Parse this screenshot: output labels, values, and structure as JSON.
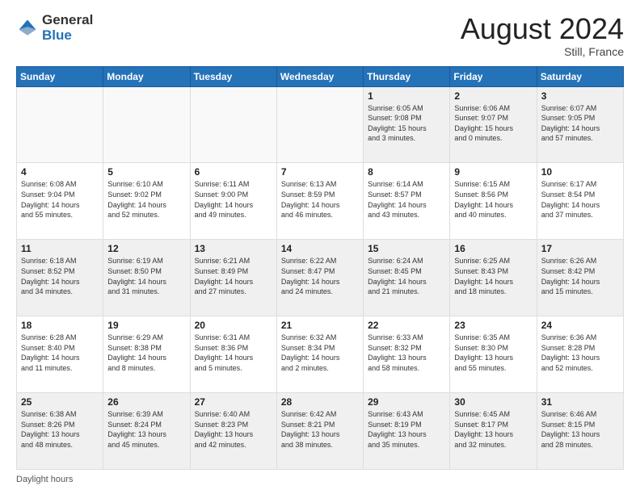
{
  "logo": {
    "general": "General",
    "blue": "Blue"
  },
  "header": {
    "month_year": "August 2024",
    "location": "Still, France"
  },
  "days_of_week": [
    "Sunday",
    "Monday",
    "Tuesday",
    "Wednesday",
    "Thursday",
    "Friday",
    "Saturday"
  ],
  "weeks": [
    [
      {
        "num": "",
        "info": "",
        "empty": true
      },
      {
        "num": "",
        "info": "",
        "empty": true
      },
      {
        "num": "",
        "info": "",
        "empty": true
      },
      {
        "num": "",
        "info": "",
        "empty": true
      },
      {
        "num": "1",
        "info": "Sunrise: 6:05 AM\nSunset: 9:08 PM\nDaylight: 15 hours\nand 3 minutes.",
        "empty": false
      },
      {
        "num": "2",
        "info": "Sunrise: 6:06 AM\nSunset: 9:07 PM\nDaylight: 15 hours\nand 0 minutes.",
        "empty": false
      },
      {
        "num": "3",
        "info": "Sunrise: 6:07 AM\nSunset: 9:05 PM\nDaylight: 14 hours\nand 57 minutes.",
        "empty": false
      }
    ],
    [
      {
        "num": "4",
        "info": "Sunrise: 6:08 AM\nSunset: 9:04 PM\nDaylight: 14 hours\nand 55 minutes.",
        "empty": false
      },
      {
        "num": "5",
        "info": "Sunrise: 6:10 AM\nSunset: 9:02 PM\nDaylight: 14 hours\nand 52 minutes.",
        "empty": false
      },
      {
        "num": "6",
        "info": "Sunrise: 6:11 AM\nSunset: 9:00 PM\nDaylight: 14 hours\nand 49 minutes.",
        "empty": false
      },
      {
        "num": "7",
        "info": "Sunrise: 6:13 AM\nSunset: 8:59 PM\nDaylight: 14 hours\nand 46 minutes.",
        "empty": false
      },
      {
        "num": "8",
        "info": "Sunrise: 6:14 AM\nSunset: 8:57 PM\nDaylight: 14 hours\nand 43 minutes.",
        "empty": false
      },
      {
        "num": "9",
        "info": "Sunrise: 6:15 AM\nSunset: 8:56 PM\nDaylight: 14 hours\nand 40 minutes.",
        "empty": false
      },
      {
        "num": "10",
        "info": "Sunrise: 6:17 AM\nSunset: 8:54 PM\nDaylight: 14 hours\nand 37 minutes.",
        "empty": false
      }
    ],
    [
      {
        "num": "11",
        "info": "Sunrise: 6:18 AM\nSunset: 8:52 PM\nDaylight: 14 hours\nand 34 minutes.",
        "empty": false
      },
      {
        "num": "12",
        "info": "Sunrise: 6:19 AM\nSunset: 8:50 PM\nDaylight: 14 hours\nand 31 minutes.",
        "empty": false
      },
      {
        "num": "13",
        "info": "Sunrise: 6:21 AM\nSunset: 8:49 PM\nDaylight: 14 hours\nand 27 minutes.",
        "empty": false
      },
      {
        "num": "14",
        "info": "Sunrise: 6:22 AM\nSunset: 8:47 PM\nDaylight: 14 hours\nand 24 minutes.",
        "empty": false
      },
      {
        "num": "15",
        "info": "Sunrise: 6:24 AM\nSunset: 8:45 PM\nDaylight: 14 hours\nand 21 minutes.",
        "empty": false
      },
      {
        "num": "16",
        "info": "Sunrise: 6:25 AM\nSunset: 8:43 PM\nDaylight: 14 hours\nand 18 minutes.",
        "empty": false
      },
      {
        "num": "17",
        "info": "Sunrise: 6:26 AM\nSunset: 8:42 PM\nDaylight: 14 hours\nand 15 minutes.",
        "empty": false
      }
    ],
    [
      {
        "num": "18",
        "info": "Sunrise: 6:28 AM\nSunset: 8:40 PM\nDaylight: 14 hours\nand 11 minutes.",
        "empty": false
      },
      {
        "num": "19",
        "info": "Sunrise: 6:29 AM\nSunset: 8:38 PM\nDaylight: 14 hours\nand 8 minutes.",
        "empty": false
      },
      {
        "num": "20",
        "info": "Sunrise: 6:31 AM\nSunset: 8:36 PM\nDaylight: 14 hours\nand 5 minutes.",
        "empty": false
      },
      {
        "num": "21",
        "info": "Sunrise: 6:32 AM\nSunset: 8:34 PM\nDaylight: 14 hours\nand 2 minutes.",
        "empty": false
      },
      {
        "num": "22",
        "info": "Sunrise: 6:33 AM\nSunset: 8:32 PM\nDaylight: 13 hours\nand 58 minutes.",
        "empty": false
      },
      {
        "num": "23",
        "info": "Sunrise: 6:35 AM\nSunset: 8:30 PM\nDaylight: 13 hours\nand 55 minutes.",
        "empty": false
      },
      {
        "num": "24",
        "info": "Sunrise: 6:36 AM\nSunset: 8:28 PM\nDaylight: 13 hours\nand 52 minutes.",
        "empty": false
      }
    ],
    [
      {
        "num": "25",
        "info": "Sunrise: 6:38 AM\nSunset: 8:26 PM\nDaylight: 13 hours\nand 48 minutes.",
        "empty": false
      },
      {
        "num": "26",
        "info": "Sunrise: 6:39 AM\nSunset: 8:24 PM\nDaylight: 13 hours\nand 45 minutes.",
        "empty": false
      },
      {
        "num": "27",
        "info": "Sunrise: 6:40 AM\nSunset: 8:23 PM\nDaylight: 13 hours\nand 42 minutes.",
        "empty": false
      },
      {
        "num": "28",
        "info": "Sunrise: 6:42 AM\nSunset: 8:21 PM\nDaylight: 13 hours\nand 38 minutes.",
        "empty": false
      },
      {
        "num": "29",
        "info": "Sunrise: 6:43 AM\nSunset: 8:19 PM\nDaylight: 13 hours\nand 35 minutes.",
        "empty": false
      },
      {
        "num": "30",
        "info": "Sunrise: 6:45 AM\nSunset: 8:17 PM\nDaylight: 13 hours\nand 32 minutes.",
        "empty": false
      },
      {
        "num": "31",
        "info": "Sunrise: 6:46 AM\nSunset: 8:15 PM\nDaylight: 13 hours\nand 28 minutes.",
        "empty": false
      }
    ]
  ],
  "footer": {
    "daylight_label": "Daylight hours"
  }
}
